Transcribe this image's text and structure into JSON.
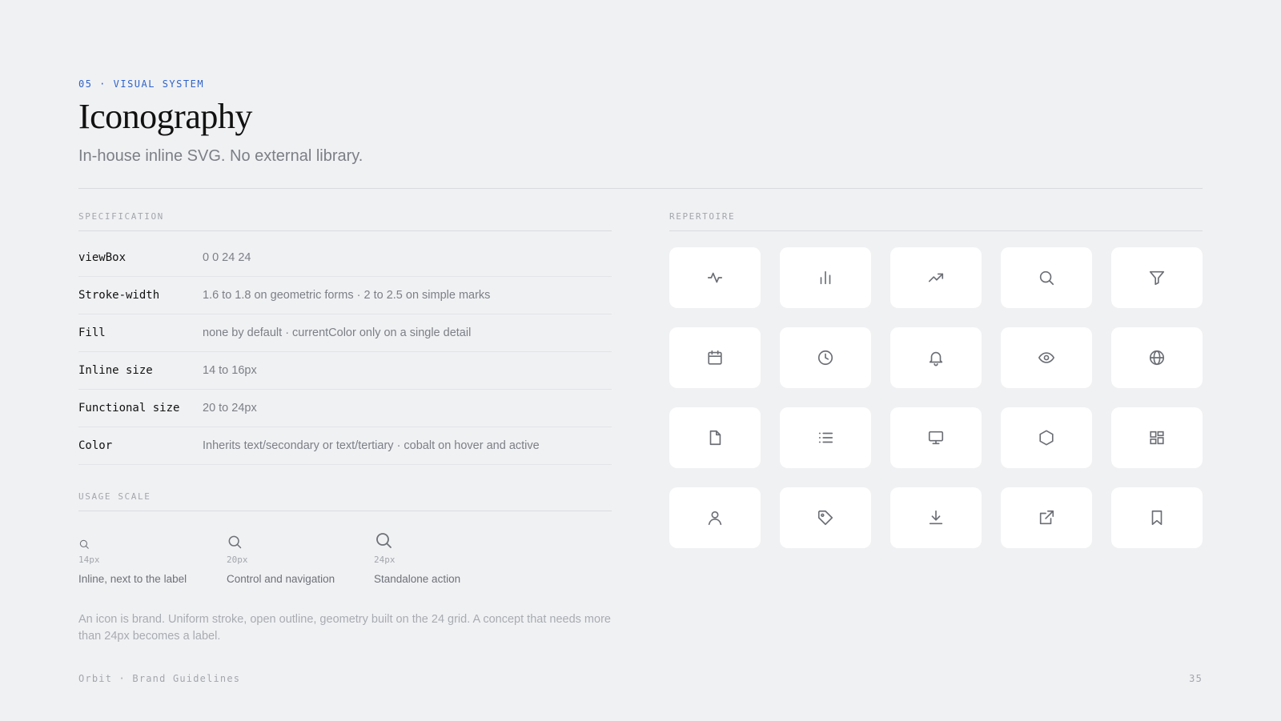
{
  "header": {
    "eyebrow": "05 · VISUAL SYSTEM",
    "title": "Iconography",
    "subtitle": "In-house inline SVG. No external library."
  },
  "specification": {
    "label": "SPECIFICATION",
    "rows": [
      {
        "key": "viewBox",
        "value": "0 0 24 24"
      },
      {
        "key": "Stroke-width",
        "value": "1.6 to 1.8 on geometric forms · 2 to 2.5 on simple marks"
      },
      {
        "key": "Fill",
        "value": "none by default · currentColor only on a single detail"
      },
      {
        "key": "Inline size",
        "value": "14 to 16px"
      },
      {
        "key": "Functional size",
        "value": "20 to 24px"
      },
      {
        "key": "Color",
        "value": "Inherits text/secondary or text/tertiary · cobalt on hover and active"
      }
    ]
  },
  "usage_scale": {
    "label": "USAGE SCALE",
    "items": [
      {
        "icon": "search-icon",
        "size": "14px",
        "description": "Inline, next to the label"
      },
      {
        "icon": "search-icon",
        "size": "20px",
        "description": "Control and navigation"
      },
      {
        "icon": "search-icon",
        "size": "24px",
        "description": "Standalone action"
      }
    ]
  },
  "note": "An icon is brand. Uniform stroke, open outline, geometry built on the 24 grid. A concept that needs more than 24px becomes a label.",
  "repertoire": {
    "label": "REPERTOIRE",
    "icons": [
      "activity-icon",
      "bar-chart-icon",
      "trending-up-icon",
      "search-icon",
      "filter-icon",
      "calendar-icon",
      "clock-icon",
      "bell-icon",
      "eye-icon",
      "globe-icon",
      "file-icon",
      "list-icon",
      "monitor-icon",
      "hexagon-icon",
      "dashboard-grid-icon",
      "user-icon",
      "tag-icon",
      "download-icon",
      "external-link-icon",
      "bookmark-icon"
    ]
  },
  "footer": {
    "brand": "Orbit · Brand Guidelines",
    "page_number": "35"
  },
  "colors": {
    "background": "#f0f1f3",
    "accent": "#2f63c9",
    "tile": "#ffffff",
    "icon": "#6b6e75"
  }
}
